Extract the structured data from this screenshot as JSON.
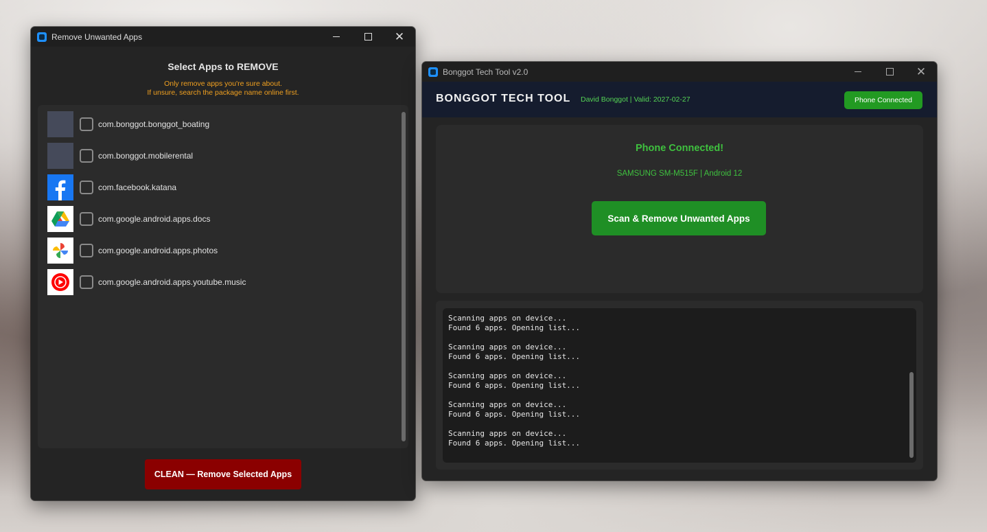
{
  "remove_window": {
    "title": "Remove Unwanted Apps",
    "heading": "Select Apps to REMOVE",
    "warning_line1": "Only remove apps you're sure about.",
    "warning_line2": "If unsure, search the package name online first.",
    "apps": [
      {
        "package": "com.bonggot.bonggot_boating",
        "icon": "placeholder-app-icon",
        "checked": false
      },
      {
        "package": "com.bonggot.mobilerental",
        "icon": "placeholder-app-icon",
        "checked": false
      },
      {
        "package": "com.facebook.katana",
        "icon": "facebook-icon",
        "checked": false
      },
      {
        "package": "com.google.android.apps.docs",
        "icon": "google-drive-icon",
        "checked": false
      },
      {
        "package": "com.google.android.apps.photos",
        "icon": "google-photos-icon",
        "checked": false
      },
      {
        "package": "com.google.android.apps.youtube.music",
        "icon": "youtube-music-icon",
        "checked": false
      }
    ],
    "clean_button": "CLEAN — Remove Selected Apps",
    "colors": {
      "warning": "#f0a020",
      "clean_button": "#8b0000"
    }
  },
  "main_window": {
    "title": "Bonggot Tech Tool v2.0",
    "brand": "BONGGOT TECH TOOL",
    "user_info": "David Bonggot  |  Valid: 2027-02-27",
    "status_badge": "Phone Connected",
    "card_title": "Phone Connected!",
    "device_info": "SAMSUNG SM-M515F  |  Android 12",
    "scan_button": "Scan & Remove Unwanted Apps",
    "log_text": "Scanning apps on device...\nFound 6 apps. Opening list...\n\nScanning apps on device...\nFound 6 apps. Opening list...\n\nScanning apps on device...\nFound 6 apps. Opening list...\n\nScanning apps on device...\nFound 6 apps. Opening list...\n\nScanning apps on device...\nFound 6 apps. Opening list...",
    "colors": {
      "header": "#151c2e",
      "accent_green": "#229a22",
      "status_text": "#3fc13f"
    }
  }
}
